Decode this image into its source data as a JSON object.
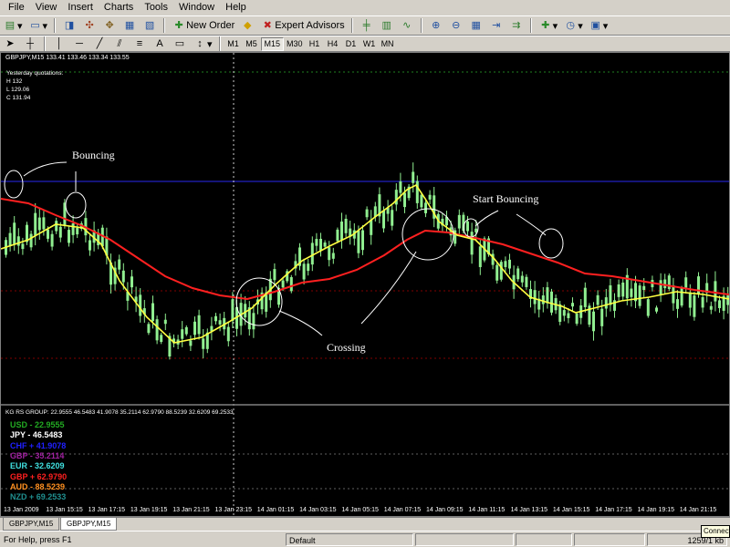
{
  "menu": [
    "File",
    "View",
    "Insert",
    "Charts",
    "Tools",
    "Window",
    "Help"
  ],
  "toolbar": {
    "new_order": "New Order",
    "expert_advisors": "Expert Advisors",
    "timeframes": [
      "M1",
      "M5",
      "M15",
      "M30",
      "H1",
      "H4",
      "D1",
      "W1",
      "MN"
    ],
    "active_timeframe": "M15"
  },
  "chart": {
    "header": "GBPJPY,M15  133.41 133.46 133.34 133.55",
    "yesterday_title": "Yesterday quotations:",
    "yesterday": [
      "H 132",
      "L 129.06",
      "C 131.94"
    ],
    "annotations": {
      "bouncing": "Bouncing",
      "start_bouncing": "Start Bouncing",
      "crossing": "Crossing"
    },
    "colors": {
      "bg": "#000000",
      "candle": "#90ee90",
      "ma_fast": "#ffff40",
      "ma_slow": "#ff2020",
      "hline_blue": "#2020c0",
      "grid_dotted": "#800000"
    }
  },
  "indicator": {
    "header": "KG RS GROUP:  22.9555 46.5483 41.9078 35.2114 62.9790 88.5239 32.6209 69.2533",
    "rows": [
      {
        "text": "USD - 22.9555",
        "color": "#22aa22"
      },
      {
        "text": "JPY - 46.5483",
        "color": "#ffffff"
      },
      {
        "text": "CHF + 41.9078",
        "color": "#2020ff"
      },
      {
        "text": "GBP - 35.2114",
        "color": "#a020a0"
      },
      {
        "text": "EUR - 32.6209",
        "color": "#40e0e0"
      },
      {
        "text": "GBP + 62.9790",
        "color": "#ff2020"
      },
      {
        "text": "AUD - 88.5239",
        "color": "#ff9020"
      },
      {
        "text": "NZD + 69.2533",
        "color": "#209090"
      }
    ]
  },
  "xaxis": [
    "13 Jan 2009",
    "13 Jan 15:15",
    "13 Jan 17:15",
    "13 Jan 19:15",
    "13 Jan 21:15",
    "13 Jan 23:15",
    "14 Jan 01:15",
    "14 Jan 03:15",
    "14 Jan 05:15",
    "14 Jan 07:15",
    "14 Jan 09:15",
    "14 Jan 11:15",
    "14 Jan 13:15",
    "14 Jan 15:15",
    "14 Jan 17:15",
    "14 Jan 19:15",
    "14 Jan 21:15"
  ],
  "tabs": [
    "GBPJPY,M15",
    "GBPJPY,M15"
  ],
  "status": {
    "help": "For Help, press F1",
    "profile": "Default",
    "traffic": "1259/1 kb",
    "tooltip": "Connect"
  }
}
